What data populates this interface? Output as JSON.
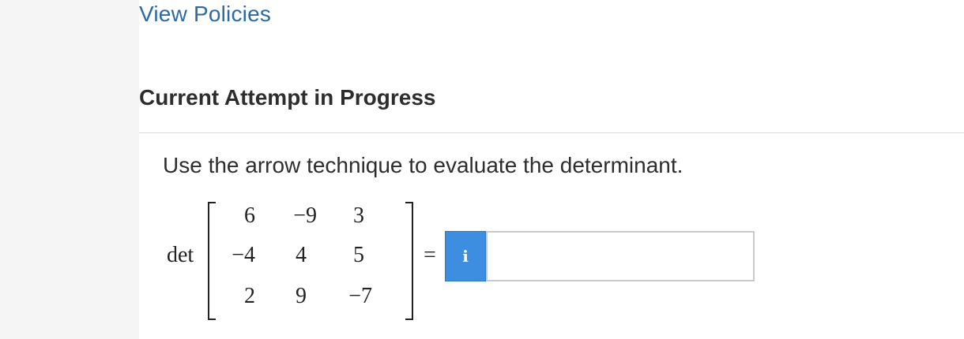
{
  "links": {
    "view_policies": "View Policies"
  },
  "attempt": {
    "title": "Current Attempt in Progress"
  },
  "question": {
    "prompt": "Use the arrow technique to evaluate the determinant.",
    "det_label": "det",
    "equals": "=",
    "matrix": [
      [
        "6",
        "−9",
        "3"
      ],
      [
        "−4",
        "4",
        "5"
      ],
      [
        "2",
        "9",
        "−7"
      ]
    ]
  },
  "answer": {
    "info_icon": "i",
    "value": "",
    "placeholder": ""
  }
}
